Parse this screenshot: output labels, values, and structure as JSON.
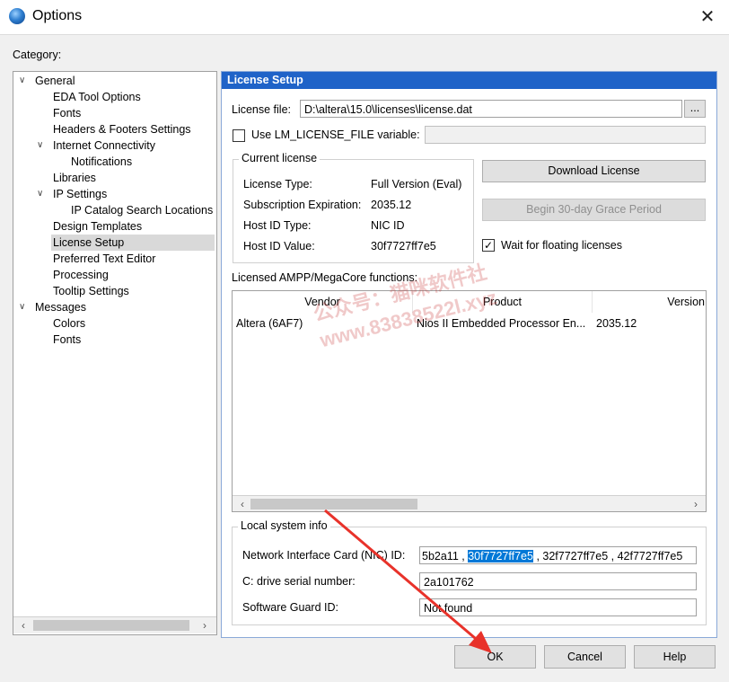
{
  "window": {
    "title": "Options",
    "close_glyph": "✕"
  },
  "category": {
    "label": "Category:",
    "tree": [
      {
        "label": "General",
        "expanded": true
      },
      {
        "label": "EDA Tool Options"
      },
      {
        "label": "Fonts"
      },
      {
        "label": "Headers & Footers Settings"
      },
      {
        "label": "Internet Connectivity",
        "expanded": true
      },
      {
        "label": "Notifications"
      },
      {
        "label": "Libraries"
      },
      {
        "label": "IP Settings",
        "expanded": true
      },
      {
        "label": "IP Catalog Search Locations"
      },
      {
        "label": "Design Templates"
      },
      {
        "label": "License Setup",
        "selected": true
      },
      {
        "label": "Preferred Text Editor"
      },
      {
        "label": "Processing"
      },
      {
        "label": "Tooltip Settings"
      },
      {
        "label": "Messages",
        "expanded": true
      },
      {
        "label": "Colors"
      },
      {
        "label": "Fonts"
      }
    ]
  },
  "panel": {
    "title": "License Setup",
    "license_file": {
      "label": "License file:",
      "value": "D:\\altera\\15.0\\licenses\\license.dat",
      "browse": "..."
    },
    "lm_license": {
      "label": "Use LM_LICENSE_FILE variable:",
      "checked": false,
      "value": ""
    },
    "current_license": {
      "title": "Current license",
      "rows": [
        {
          "label": "License Type:",
          "value": "Full Version (Eval)"
        },
        {
          "label": "Subscription Expiration:",
          "value": "2035.12"
        },
        {
          "label": "Host ID Type:",
          "value": "NIC ID"
        },
        {
          "label": "Host ID Value:",
          "value": "30f7727ff7e5"
        }
      ]
    },
    "download_btn": "Download License",
    "grace_btn": "Begin 30-day Grace Period",
    "wait_floating": {
      "label": "Wait for floating licenses",
      "checked": true
    },
    "functions": {
      "label": "Licensed AMPP/MegaCore functions:",
      "columns": [
        "Vendor",
        "Product",
        "Version"
      ],
      "rows": [
        {
          "vendor": "Altera (6AF7)",
          "product": "Nios II Embedded Processor En...",
          "version": "2035.12"
        }
      ]
    },
    "local": {
      "title": "Local system info",
      "nic_label": "Network Interface Card (NIC) ID:",
      "nic_parts": [
        "5b2a11 , ",
        "30f7727ff7e5",
        " , 32f7727ff7e5 , 42f7727ff7e5"
      ],
      "drive_label": "C: drive serial number:",
      "drive_value": "2a101762",
      "guard_label": "Software Guard ID:",
      "guard_value": "Not found"
    }
  },
  "footer": {
    "ok": "OK",
    "cancel": "Cancel",
    "help": "Help"
  },
  "watermark": {
    "line1": "公众号：猫咪软件社",
    "line2": "www.83838522l.xyz"
  },
  "colors": {
    "accent": "#1f63c8",
    "selection": "#0078d7",
    "arrow": "#e8322a"
  }
}
